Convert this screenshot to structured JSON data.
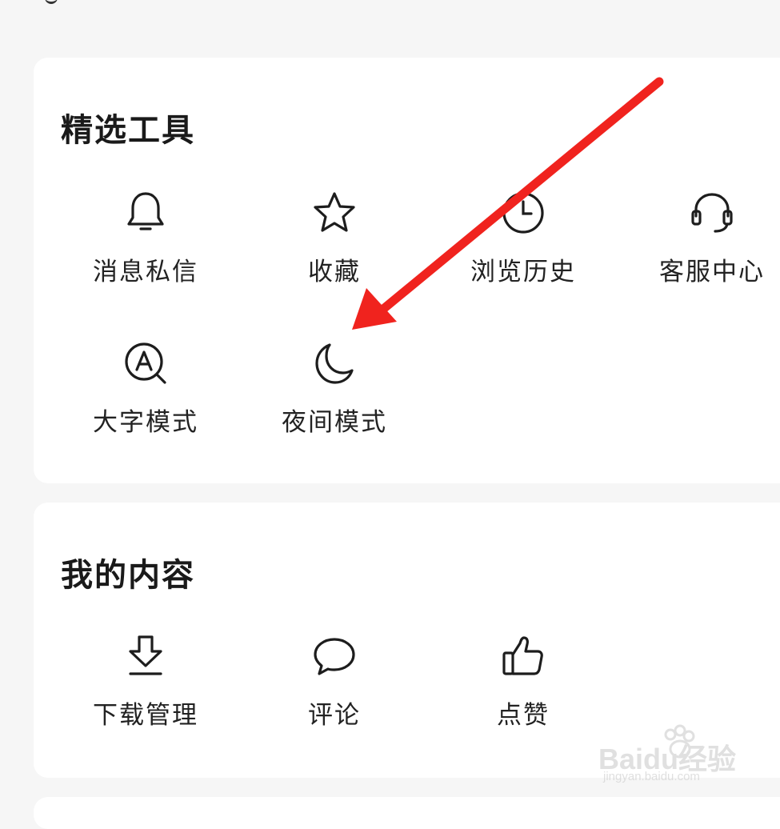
{
  "tools_section": {
    "title": "精选工具",
    "items": [
      {
        "label": "消息私信",
        "icon": "bell-icon"
      },
      {
        "label": "收藏",
        "icon": "star-icon"
      },
      {
        "label": "浏览历史",
        "icon": "clock-icon"
      },
      {
        "label": "客服中心",
        "icon": "headset-icon"
      },
      {
        "label": "大字模式",
        "icon": "large-text-icon"
      },
      {
        "label": "夜间模式",
        "icon": "moon-icon"
      }
    ]
  },
  "content_section": {
    "title": "我的内容",
    "items": [
      {
        "label": "下载管理",
        "icon": "download-icon"
      },
      {
        "label": "评论",
        "icon": "comment-icon"
      },
      {
        "label": "点赞",
        "icon": "thumbs-up-icon"
      }
    ]
  },
  "annotation": {
    "arrow_color": "#f0231e"
  },
  "watermark": {
    "main": "Baidu经验",
    "sub": "jingyan.baidu.com"
  }
}
